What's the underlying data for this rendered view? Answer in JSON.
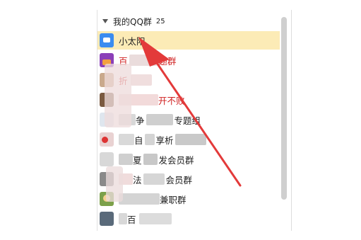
{
  "group": {
    "name": "我的QQ群",
    "count": "25"
  },
  "rows": [
    {
      "label": "小太阳",
      "avatar": "chat-bubble-icon"
    },
    {
      "label_a": "百",
      "label_b": "题群"
    },
    {
      "label_a": "折"
    },
    {
      "label_b": "开不败"
    },
    {
      "label_a": "争",
      "label_b": "专题组"
    },
    {
      "label_a": "自",
      "label_b": "享析"
    },
    {
      "label_a": "夏",
      "label_b": "发会员群"
    },
    {
      "label_a": "法",
      "label_b": "会员群"
    },
    {
      "label_b": "兼职群"
    },
    {
      "label_a": "百"
    }
  ],
  "colors": {
    "selected": "#fcebb6",
    "red_text": "#d02020",
    "arrow": "#e33a3a"
  }
}
